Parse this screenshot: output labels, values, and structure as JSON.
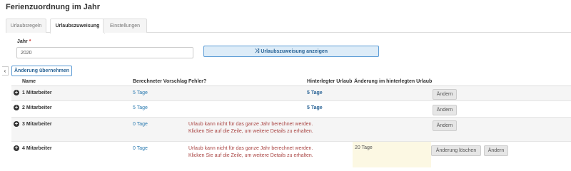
{
  "page": {
    "title": "Ferienzuordnung im Jahr"
  },
  "tabs": [
    {
      "label": "Urlaubsregeln",
      "active": false
    },
    {
      "label": "Urlaubszuweisung",
      "active": true
    },
    {
      "label": "Einstellungen",
      "active": false
    }
  ],
  "form": {
    "year_label": "Jahr",
    "required_mark": "*",
    "year_value": "2020",
    "show_button_label": "Urlaubszuweisung anzeigen"
  },
  "toolbar": {
    "apply_label": "Änderung übernehmen"
  },
  "table": {
    "headers": {
      "name": "Name",
      "proposal": "Berechneter Vorschlag",
      "error": "Fehler?",
      "stored": "Hinterlegter Urlaub",
      "change": "Änderung im hinterlegten Urlaub"
    },
    "rows": [
      {
        "name": "1 Mitarbeiter",
        "proposal": "5 Tage",
        "error": "",
        "stored": "5 Tage",
        "change": "",
        "delete_label": "",
        "change_label": "Ändern"
      },
      {
        "name": "2 Mitarbeiter",
        "proposal": "5 Tage",
        "error": "",
        "stored": "5 Tage",
        "change": "",
        "delete_label": "",
        "change_label": "Ändern"
      },
      {
        "name": "3 Mitarbeiter",
        "proposal": "0 Tage",
        "error": "Urlaub kann nicht für das ganze Jahr berechnet werden. Klicken Sie auf die Zeile, um weitere Details zu erhalten.",
        "stored": "",
        "change": "",
        "delete_label": "",
        "change_label": "Ändern"
      },
      {
        "name": "4 Mitarbeiter",
        "proposal": "0 Tage",
        "error": "Urlaub kann nicht für das ganze Jahr berechnet werden. Klicken Sie auf die Zeile, um weitere Details zu erhalten.",
        "stored": "",
        "change": "20 Tage",
        "delete_label": "Änderung löschen",
        "change_label": "Ändern"
      }
    ]
  },
  "icons": {
    "expand": "plus-circle-icon",
    "shuffle": "shuffle-icon",
    "collapse": "chevron-left-icon"
  },
  "colors": {
    "accent": "#2a7ab0",
    "error": "#a94442",
    "highlight": "#fcf8e3"
  }
}
